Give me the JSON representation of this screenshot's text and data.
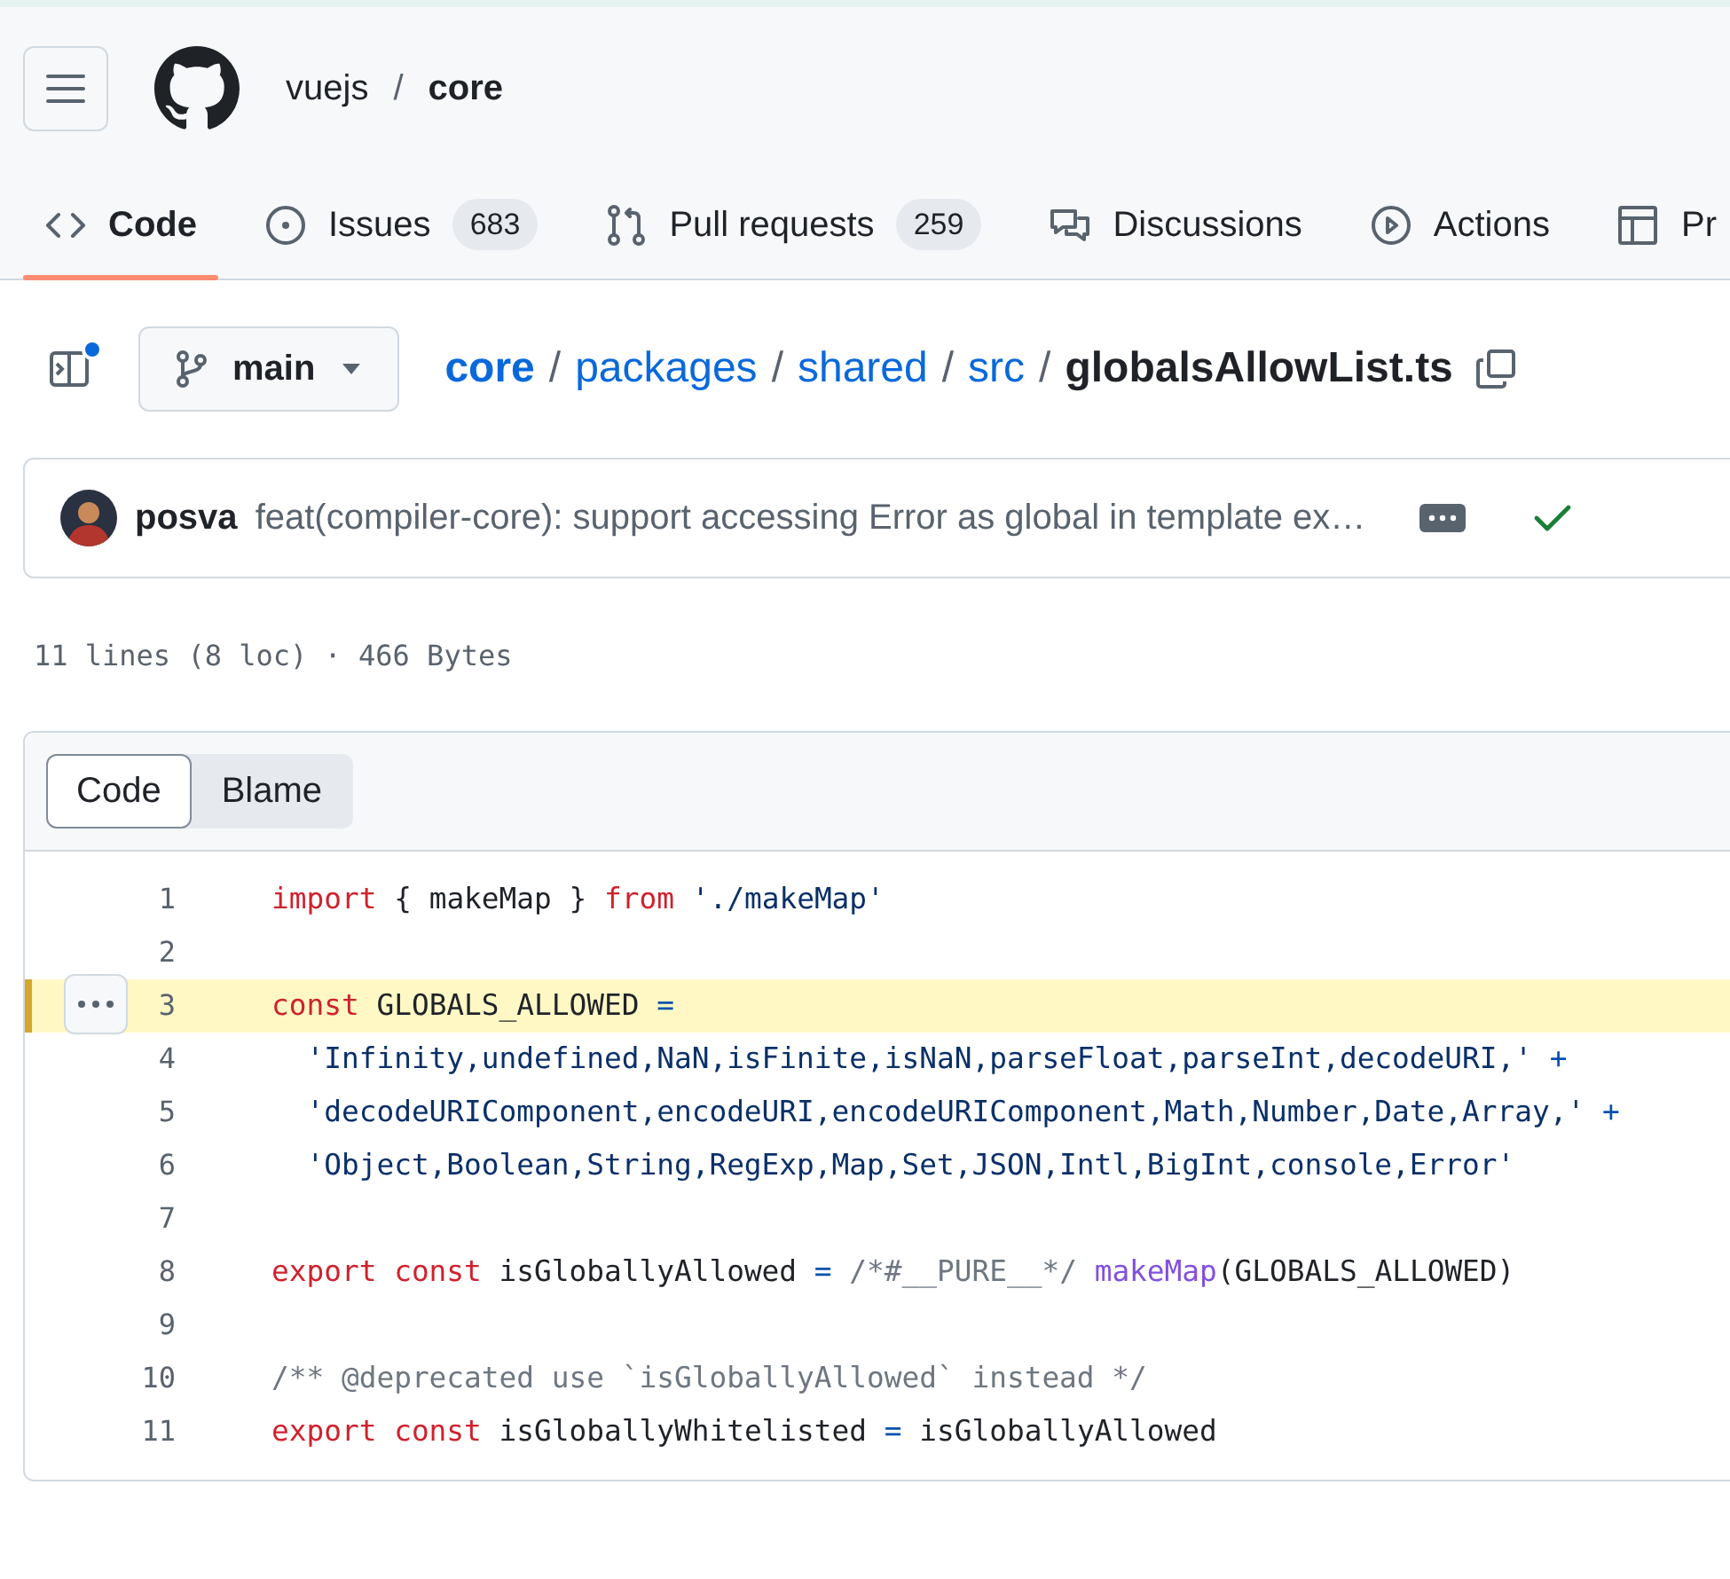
{
  "header": {
    "owner": "vuejs",
    "separator": "/",
    "repo": "core"
  },
  "tabs": [
    {
      "label": "Code",
      "kind": "code",
      "selected": true
    },
    {
      "label": "Issues",
      "kind": "issue",
      "count": "683",
      "selected": false
    },
    {
      "label": "Pull requests",
      "kind": "pull",
      "count": "259",
      "selected": false
    },
    {
      "label": "Discussions",
      "kind": "discussion",
      "selected": false
    },
    {
      "label": "Actions",
      "kind": "play",
      "selected": false
    },
    {
      "label": "Pr",
      "kind": "table",
      "selected": false
    }
  ],
  "file_nav": {
    "branch": "main",
    "sidebar_notice": true,
    "path": [
      {
        "text": "core",
        "kind": "root"
      },
      {
        "text": "/",
        "kind": "separator"
      },
      {
        "text": "packages",
        "kind": "link"
      },
      {
        "text": "/",
        "kind": "separator"
      },
      {
        "text": "shared",
        "kind": "link"
      },
      {
        "text": "/",
        "kind": "separator"
      },
      {
        "text": "src",
        "kind": "link"
      },
      {
        "text": "/",
        "kind": "separator"
      },
      {
        "text": "globalsAllowList.ts",
        "kind": "current"
      }
    ]
  },
  "commit": {
    "author": "posva",
    "message": "feat(compiler-core): support accessing Error as global in template ex…",
    "passed": true
  },
  "file_info": "11 lines (8 loc) · 466 Bytes",
  "view_tabs": [
    {
      "label": "Code",
      "selected": true
    },
    {
      "label": "Blame",
      "selected": false
    }
  ],
  "lines": [
    {
      "number": "1",
      "highlighted": false,
      "tokens": [
        {
          "kind": "keyword",
          "text": "import"
        },
        {
          "kind": "plain",
          "text": " { makeMap } "
        },
        {
          "kind": "keyword",
          "text": "from"
        },
        {
          "kind": "string",
          "text": " './makeMap'"
        }
      ]
    },
    {
      "number": "2",
      "highlighted": false
    },
    {
      "number": "3",
      "highlighted": true,
      "tokens": [
        {
          "kind": "keyword",
          "text": "const"
        },
        {
          "kind": "plain",
          "text": " GLOBALS_ALLOWED "
        },
        {
          "kind": "operator",
          "text": "="
        }
      ]
    },
    {
      "number": "4",
      "highlighted": false,
      "tokens": [
        {
          "kind": "string",
          "text": "  'Infinity,undefined,NaN,isFinite,isNaN,parseFloat,parseInt,decodeURI,'"
        },
        {
          "kind": "operator",
          "text": " +"
        }
      ]
    },
    {
      "number": "5",
      "highlighted": false,
      "tokens": [
        {
          "kind": "string",
          "text": "  'decodeURIComponent,encodeURI,encodeURIComponent,Math,Number,Date,Array,'"
        },
        {
          "kind": "operator",
          "text": " +"
        }
      ]
    },
    {
      "number": "6",
      "highlighted": false,
      "tokens": [
        {
          "kind": "string",
          "text": "  'Object,Boolean,String,RegExp,Map,Set,JSON,Intl,BigInt,console,Error'"
        }
      ]
    },
    {
      "number": "7",
      "highlighted": false
    },
    {
      "number": "8",
      "highlighted": false,
      "tokens": [
        {
          "kind": "keyword",
          "text": "export const"
        },
        {
          "kind": "plain",
          "text": " isGloballyAllowed "
        },
        {
          "kind": "operator",
          "text": "="
        },
        {
          "kind": "comment",
          "text": " /*#__PURE__*/"
        },
        {
          "kind": "function",
          "text": " makeMap"
        },
        {
          "kind": "plain",
          "text": "(GLOBALS_ALLOWED)"
        }
      ]
    },
    {
      "number": "9",
      "highlighted": false
    },
    {
      "number": "10",
      "highlighted": false,
      "tokens": [
        {
          "kind": "comment",
          "text": "/** @deprecated use `isGloballyAllowed` instead */"
        }
      ]
    },
    {
      "number": "11",
      "highlighted": false,
      "tokens": [
        {
          "kind": "keyword",
          "text": "export const"
        },
        {
          "kind": "plain",
          "text": " isGloballyWhitelisted "
        },
        {
          "kind": "operator",
          "text": "="
        },
        {
          "kind": "plain",
          "text": " isGloballyAllowed"
        }
      ]
    }
  ]
}
